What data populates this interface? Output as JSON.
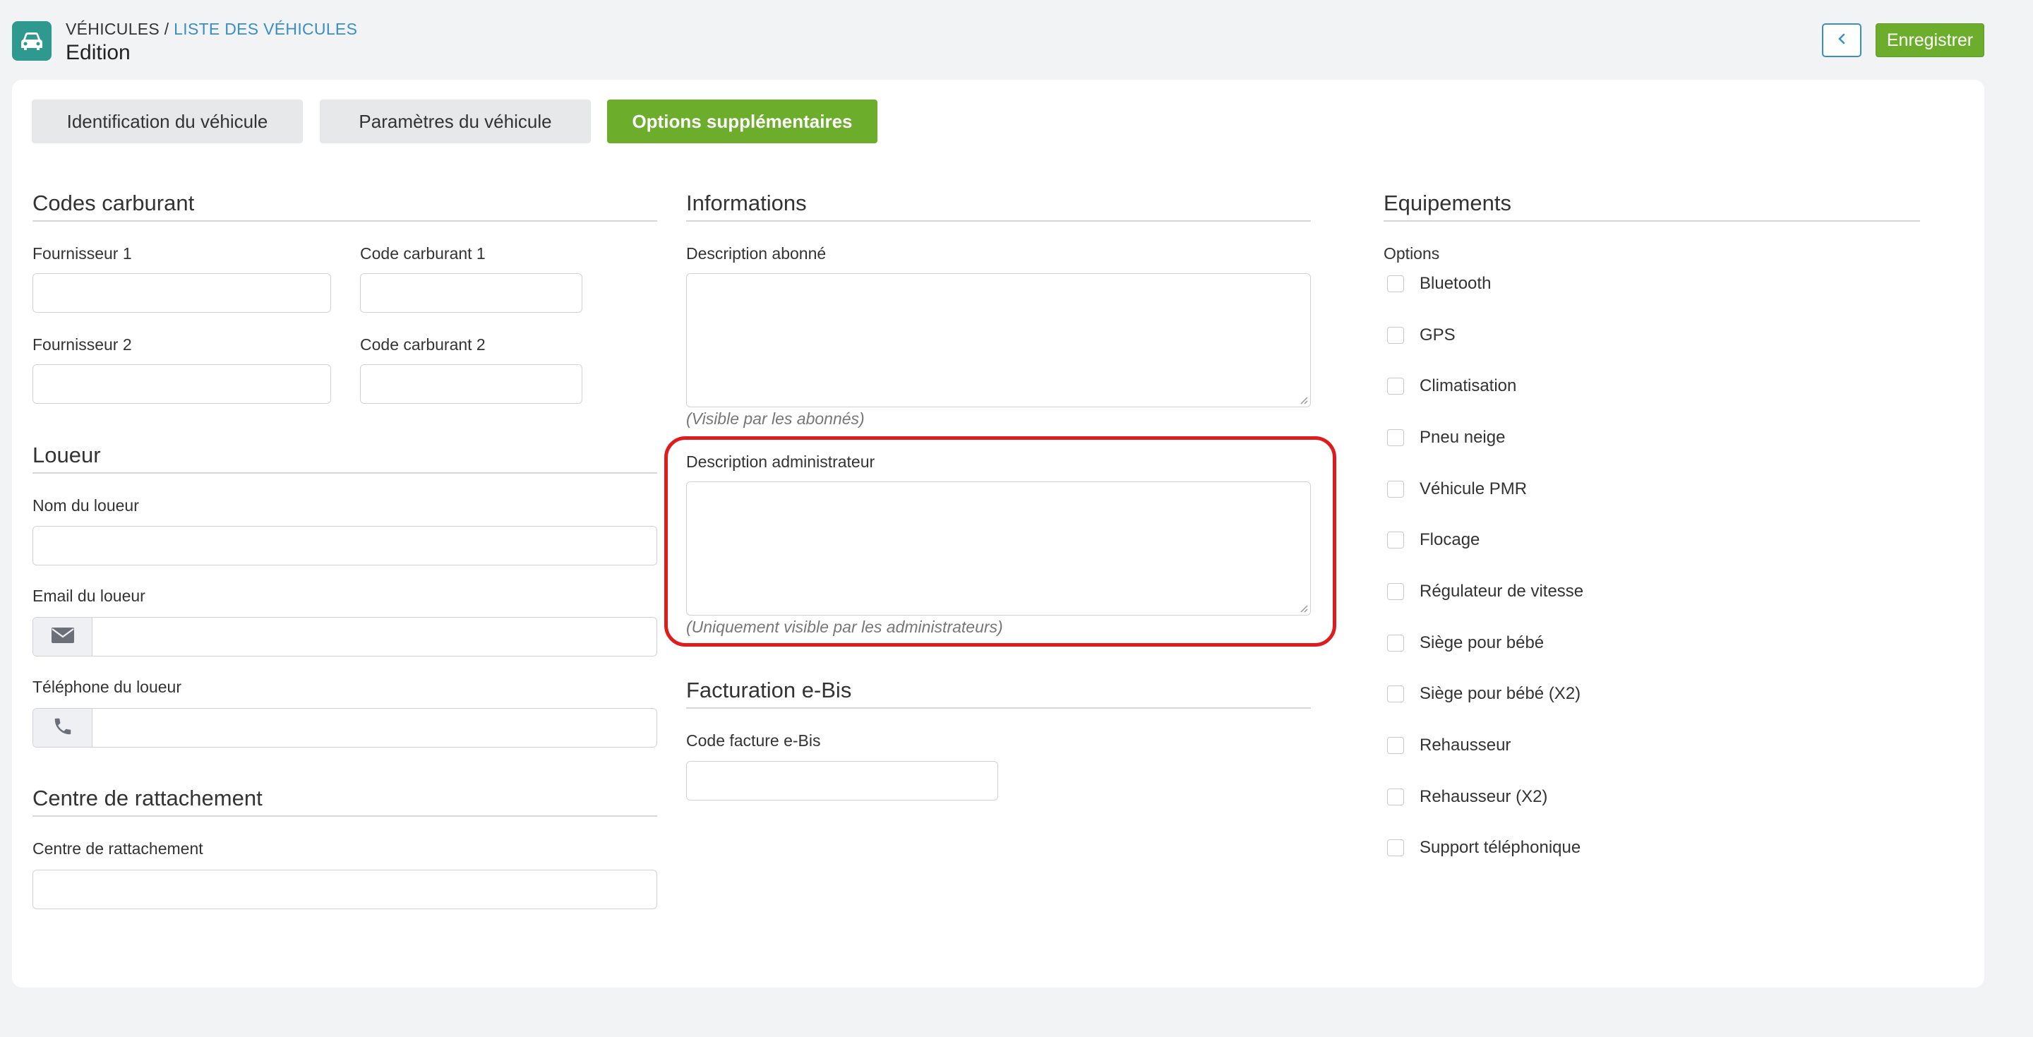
{
  "header": {
    "breadcrumb_root": "VÉHICULES",
    "breadcrumb_separator": " / ",
    "breadcrumb_link": "LISTE DES VÉHICULES",
    "title": "Edition",
    "save_label": "Enregistrer"
  },
  "tabs": [
    {
      "label": "Identification du véhicule",
      "active": false
    },
    {
      "label": "Paramètres du véhicule",
      "active": false
    },
    {
      "label": "Options supplémentaires",
      "active": true
    }
  ],
  "fuel": {
    "title": "Codes carburant",
    "supplier1_label": "Fournisseur 1",
    "code1_label": "Code carburant 1",
    "supplier2_label": "Fournisseur 2",
    "code2_label": "Code carburant 2"
  },
  "lessor": {
    "title": "Loueur",
    "name_label": "Nom du loueur",
    "email_label": "Email du loueur",
    "phone_label": "Téléphone du loueur"
  },
  "center": {
    "title": "Centre de rattachement",
    "label": "Centre de rattachement"
  },
  "info": {
    "title": "Informations",
    "subscriber_label": "Description abonné",
    "subscriber_hint": "(Visible par les abonnés)",
    "admin_label": "Description administrateur",
    "admin_hint": "(Uniquement visible par les administrateurs)"
  },
  "billing": {
    "title": "Facturation e-Bis",
    "code_label": "Code facture e-Bis"
  },
  "equipment": {
    "title": "Equipements",
    "options_label": "Options",
    "options": [
      "Bluetooth",
      "GPS",
      "Climatisation",
      "Pneu neige",
      "Véhicule PMR",
      "Flocage",
      "Régulateur de vitesse",
      "Siège pour bébé",
      "Siège pour bébé (X2)",
      "Rehausseur",
      "Rehausseur (X2)",
      "Support téléphonique"
    ]
  },
  "colors": {
    "accent_green": "#6cae2b",
    "link_blue": "#3a8fc2",
    "app_icon_teal": "#2e9a8f",
    "highlight_red": "#e01b1b"
  },
  "icons": {
    "app": "car-icon",
    "back": "chevron-left-icon",
    "email": "envelope-icon",
    "phone": "phone-icon"
  }
}
